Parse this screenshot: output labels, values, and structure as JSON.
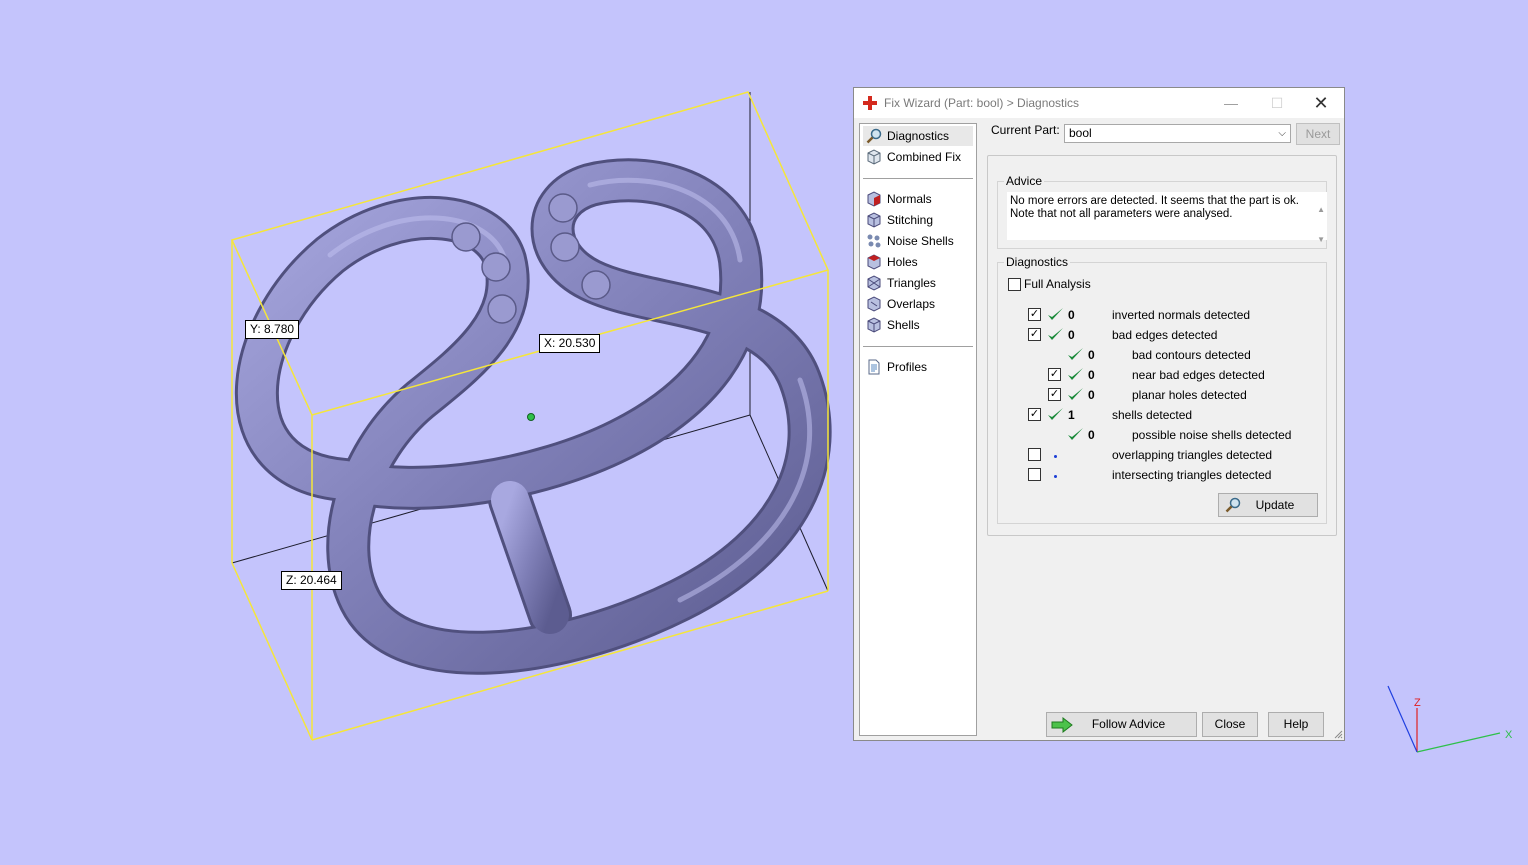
{
  "viewport": {
    "dim_y": "Y: 8.780",
    "dim_x": "X: 20.530",
    "dim_z": "Z: 20.464",
    "axis_labels": {
      "x": "X",
      "z": "Z"
    }
  },
  "dialog": {
    "title": "Fix Wizard (Part: bool) > Diagnostics",
    "window_buttons": {
      "minimize": "—",
      "maximize": "☐",
      "close": "✕"
    },
    "nav": {
      "top": [
        {
          "label": "Diagnostics",
          "icon": "magnifier-icon"
        },
        {
          "label": "Combined Fix",
          "icon": "cube-icon"
        }
      ],
      "tools": [
        {
          "label": "Normals",
          "icon": "normals-icon"
        },
        {
          "label": "Stitching",
          "icon": "stitching-icon"
        },
        {
          "label": "Noise Shells",
          "icon": "noise-shells-icon"
        },
        {
          "label": "Holes",
          "icon": "holes-icon"
        },
        {
          "label": "Triangles",
          "icon": "triangles-icon"
        },
        {
          "label": "Overlaps",
          "icon": "overlaps-icon"
        },
        {
          "label": "Shells",
          "icon": "shells-icon"
        }
      ],
      "bottom": [
        {
          "label": "Profiles",
          "icon": "document-icon"
        }
      ]
    },
    "current_part_label": "Current Part:",
    "current_part_value": "bool",
    "next_label": "Next",
    "advice": {
      "title": "Advice",
      "line1": "No more errors are detected. It seems that the part is ok.",
      "line2": "Note that not all parameters were analysed."
    },
    "diagnostics": {
      "title": "Diagnostics",
      "full_analysis_label": "Full Analysis",
      "rows": [
        {
          "checked": true,
          "status": "ok",
          "count": "0",
          "label": "inverted normals detected",
          "indent": 0
        },
        {
          "checked": true,
          "status": "ok",
          "count": "0",
          "label": "bad edges detected",
          "indent": 0
        },
        {
          "checked": null,
          "status": "ok",
          "count": "0",
          "label": "bad contours detected",
          "indent": 1
        },
        {
          "checked": true,
          "status": "ok",
          "count": "0",
          "label": "near bad edges detected",
          "indent": 1
        },
        {
          "checked": true,
          "status": "ok",
          "count": "0",
          "label": "planar holes detected",
          "indent": 1
        },
        {
          "checked": true,
          "status": "ok",
          "count": "1",
          "label": "shells detected",
          "indent": 0
        },
        {
          "checked": null,
          "status": "ok",
          "count": "0",
          "label": "possible noise shells detected",
          "indent": 1
        },
        {
          "checked": false,
          "status": "pending",
          "count": "",
          "label": "overlapping triangles detected",
          "indent": 0
        },
        {
          "checked": false,
          "status": "pending",
          "count": "",
          "label": "intersecting triangles detected",
          "indent": 0
        }
      ],
      "update_label": "Update"
    },
    "buttons": {
      "follow_advice": "Follow Advice",
      "close": "Close",
      "help": "Help"
    }
  },
  "colors": {
    "background": "#c4c4fc",
    "bounding_box": "#f5e63a",
    "model": "#8c8cc4",
    "check_green": "#1a8a3a"
  }
}
